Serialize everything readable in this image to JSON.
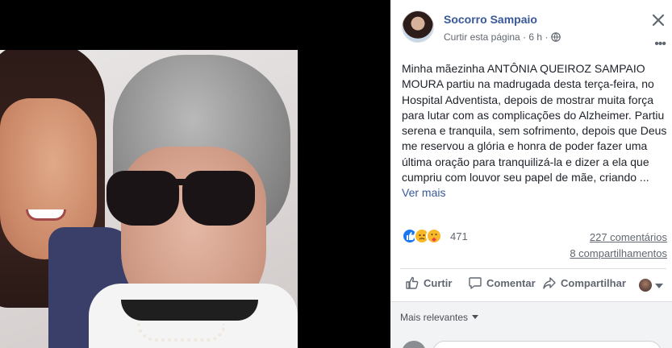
{
  "post": {
    "page_name": "Socorro Sampaio",
    "follow_label": "Curtir esta página",
    "separator": "·",
    "time_ago": "6 h",
    "body": "Minha mãezinha ANTÔNIA QUEIROZ SAMPAIO MOURA partiu na madrugada desta terça-feira, no Hospital Adventista, depois de mostrar muita força para lutar com as complicações do Alzheimer. Partiu serena e tranquila, sem sofrimento, depois que Deus me reservou a glória e honra de poder fazer uma última oração para tranquilizá-la e dizer a ela que cumpriu com louvor seu papel de mãe, criando ...",
    "see_more": "Ver mais"
  },
  "stats": {
    "reaction_count": "471",
    "comments": "227 comentários",
    "shares": "8 compartilhamentos"
  },
  "actions": {
    "like": "Curtir",
    "comment": "Comentar",
    "share": "Compartilhar"
  },
  "comments": {
    "sort_label": "Mais relevantes"
  },
  "colors": {
    "link": "#385898",
    "muted": "#606770",
    "like_blue": "#1877f2",
    "reaction_yellow": "#f7b928"
  },
  "icons": [
    "close-icon",
    "more-options-icon",
    "globe-icon",
    "like-icon",
    "comment-icon",
    "share-icon"
  ]
}
